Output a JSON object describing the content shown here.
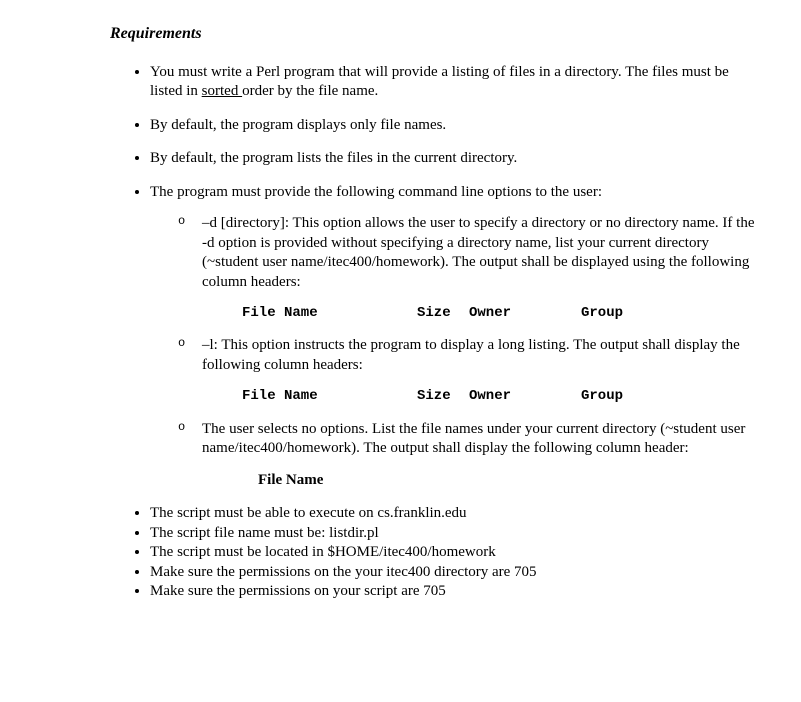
{
  "heading": "Requirements",
  "bullets": {
    "b1_pre": "You must write a Perl program that will provide a listing of files in a directory. The files must be listed in ",
    "b1_u": "sorted ",
    "b1_post": "order by the file name.",
    "b2": "By default, the program displays only file names.",
    "b3": "By default, the program lists the files in the current directory.",
    "b4": "The program must provide the following command line options to the user:",
    "sub": {
      "s1": "–d [directory]: This option allows the user to specify a directory or no directory name. If the -d option is provided without specifying a directory name, list your current directory (~student user name/itec400/homework). The output shall be displayed using the following column headers:",
      "s2": "–l: This option instructs the program to display a long listing. The output shall display the following column headers:",
      "s3": "The user selects no options. List the file names under your current directory (~student user name/itec400/homework). The output shall display the following column header:"
    },
    "b5": "The script must be able to execute on cs.franklin.edu",
    "b6": "The script file name must be: listdir.pl",
    "b7": "The script must be located in $HOME/itec400/homework",
    "b8": "Make sure the permissions on the your itec400 directory are 705",
    "b9": "Make sure the permissions on your script are 705"
  },
  "columns": {
    "file": "File Name",
    "size": "Size",
    "owner": "Owner",
    "group": "Group"
  },
  "single_header": "File Name"
}
